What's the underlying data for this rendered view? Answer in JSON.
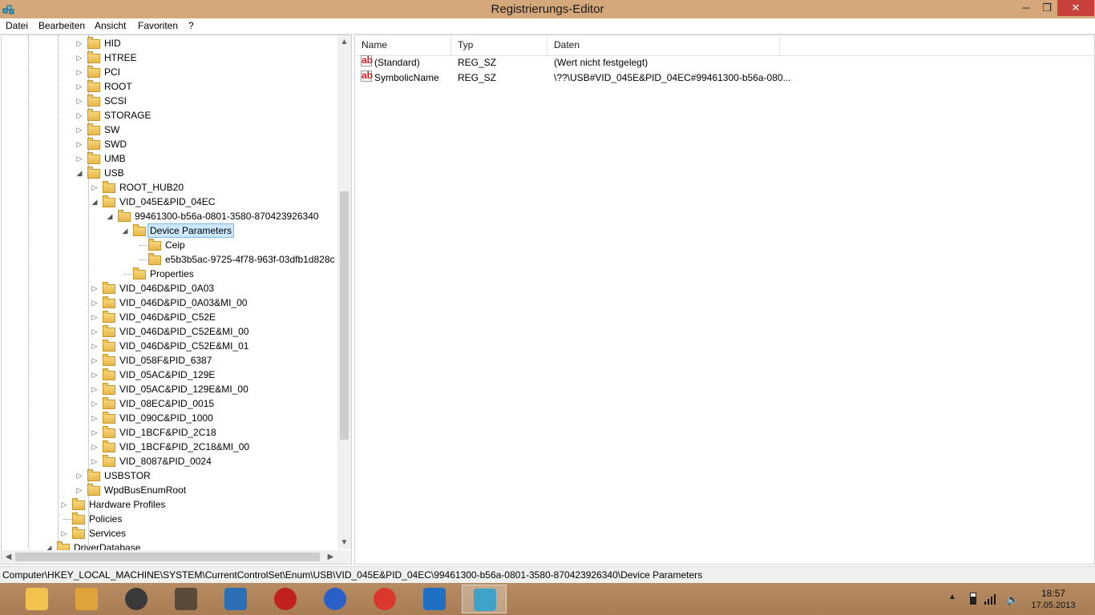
{
  "window": {
    "title": "Registrierungs-Editor",
    "controls": {
      "minimize": "─",
      "maximize": "❐",
      "close": "✕"
    }
  },
  "menu": [
    "Datei",
    "Bearbeiten",
    "Ansicht",
    "Favoriten",
    "?"
  ],
  "tree": [
    {
      "label": "HID",
      "level": 2,
      "expander": "collapsed"
    },
    {
      "label": "HTREE",
      "level": 2,
      "expander": "collapsed"
    },
    {
      "label": "PCI",
      "level": 2,
      "expander": "collapsed"
    },
    {
      "label": "ROOT",
      "level": 2,
      "expander": "collapsed"
    },
    {
      "label": "SCSI",
      "level": 2,
      "expander": "collapsed"
    },
    {
      "label": "STORAGE",
      "level": 2,
      "expander": "collapsed"
    },
    {
      "label": "SW",
      "level": 2,
      "expander": "collapsed"
    },
    {
      "label": "SWD",
      "level": 2,
      "expander": "collapsed"
    },
    {
      "label": "UMB",
      "level": 2,
      "expander": "collapsed"
    },
    {
      "label": "USB",
      "level": 2,
      "expander": "expanded"
    },
    {
      "label": "ROOT_HUB20",
      "level": 3,
      "expander": "collapsed"
    },
    {
      "label": "VID_045E&PID_04EC",
      "level": 3,
      "expander": "expanded"
    },
    {
      "label": "99461300-b56a-0801-3580-870423926340",
      "level": 4,
      "expander": "expanded"
    },
    {
      "label": "Device Parameters",
      "level": 5,
      "expander": "expanded",
      "selected": true
    },
    {
      "label": "Ceip",
      "level": 6,
      "expander": "none"
    },
    {
      "label": "e5b3b5ac-9725-4f78-963f-03dfb1d828c",
      "level": 6,
      "expander": "none"
    },
    {
      "label": "Properties",
      "level": 5,
      "expander": "none"
    },
    {
      "label": "VID_046D&PID_0A03",
      "level": 3,
      "expander": "collapsed"
    },
    {
      "label": "VID_046D&PID_0A03&MI_00",
      "level": 3,
      "expander": "collapsed"
    },
    {
      "label": "VID_046D&PID_C52E",
      "level": 3,
      "expander": "collapsed"
    },
    {
      "label": "VID_046D&PID_C52E&MI_00",
      "level": 3,
      "expander": "collapsed"
    },
    {
      "label": "VID_046D&PID_C52E&MI_01",
      "level": 3,
      "expander": "collapsed"
    },
    {
      "label": "VID_058F&PID_6387",
      "level": 3,
      "expander": "collapsed"
    },
    {
      "label": "VID_05AC&PID_129E",
      "level": 3,
      "expander": "collapsed"
    },
    {
      "label": "VID_05AC&PID_129E&MI_00",
      "level": 3,
      "expander": "collapsed"
    },
    {
      "label": "VID_08EC&PID_0015",
      "level": 3,
      "expander": "collapsed"
    },
    {
      "label": "VID_090C&PID_1000",
      "level": 3,
      "expander": "collapsed"
    },
    {
      "label": "VID_1BCF&PID_2C18",
      "level": 3,
      "expander": "collapsed"
    },
    {
      "label": "VID_1BCF&PID_2C18&MI_00",
      "level": 3,
      "expander": "collapsed"
    },
    {
      "label": "VID_8087&PID_0024",
      "level": 3,
      "expander": "collapsed"
    },
    {
      "label": "USBSTOR",
      "level": 2,
      "expander": "collapsed"
    },
    {
      "label": "WpdBusEnumRoot",
      "level": 2,
      "expander": "collapsed"
    },
    {
      "label": "Hardware Profiles",
      "level": 1,
      "expander": "collapsed"
    },
    {
      "label": "Policies",
      "level": 1,
      "expander": "none"
    },
    {
      "label": "Services",
      "level": 1,
      "expander": "collapsed"
    },
    {
      "label": "DriverDatabase",
      "level": 0,
      "expander": "expanded"
    }
  ],
  "values": {
    "columns": [
      "Name",
      "Typ",
      "Daten"
    ],
    "rows": [
      {
        "icon": "string-value-icon",
        "icon_text": "ab",
        "name": "(Standard)",
        "type": "REG_SZ",
        "data": "(Wert nicht festgelegt)"
      },
      {
        "icon": "string-value-icon",
        "icon_text": "ab",
        "name": "SymbolicName",
        "type": "REG_SZ",
        "data": "\\??\\USB#VID_045E&PID_04EC#99461300-b56a-080..."
      }
    ]
  },
  "status": {
    "path": "Computer\\HKEY_LOCAL_MACHINE\\SYSTEM\\CurrentControlSet\\Enum\\USB\\VID_045E&PID_04EC\\99461300-b56a-0801-3580-870423926340\\Device Parameters"
  },
  "taskbar": {
    "apps": [
      {
        "name": "file-explorer-icon",
        "color": "#f2c24e"
      },
      {
        "name": "disk-tool-icon",
        "color": "#e0a23a"
      },
      {
        "name": "speaker-app-icon",
        "color": "#3a3a3a"
      },
      {
        "name": "doc-app-icon",
        "color": "#5a4a3a"
      },
      {
        "name": "settings-app-icon",
        "color": "#2d6fb5"
      },
      {
        "name": "power-app-icon",
        "color": "#c02020"
      },
      {
        "name": "compass-app-icon",
        "color": "#2a5fc8"
      },
      {
        "name": "chrome-icon",
        "color": "#d9392d"
      },
      {
        "name": "lync-icon",
        "color": "#1f6fc3"
      },
      {
        "name": "regedit-icon",
        "color": "#3fa2c8"
      }
    ],
    "active_index": 9,
    "clock": {
      "time": "18:57",
      "date": "17.05.2013"
    }
  }
}
